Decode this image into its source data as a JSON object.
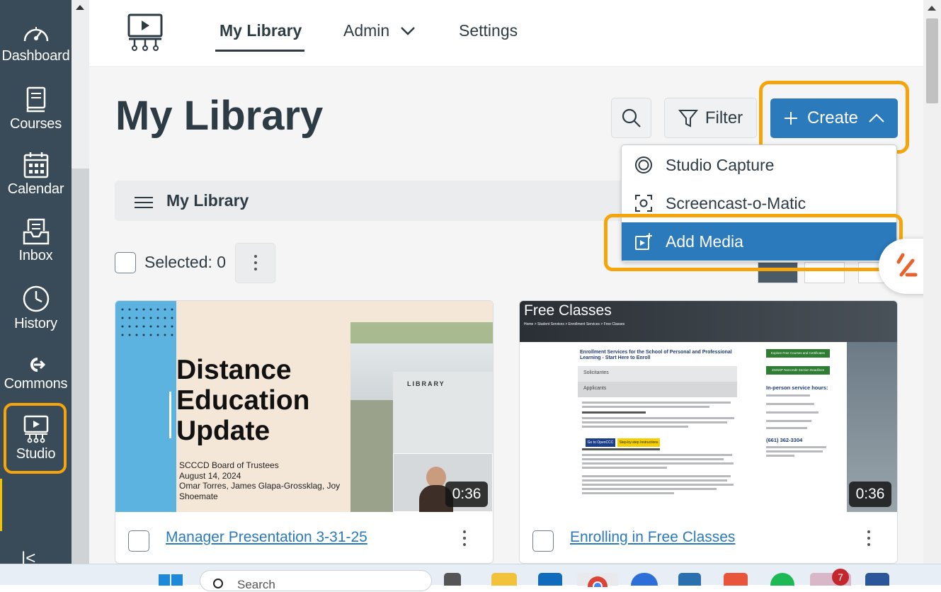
{
  "sidebar": {
    "items": [
      {
        "label": "Dashboard",
        "icon": "dashboard-icon"
      },
      {
        "label": "Courses",
        "icon": "courses-icon"
      },
      {
        "label": "Calendar",
        "icon": "calendar-icon"
      },
      {
        "label": "Inbox",
        "icon": "inbox-icon"
      },
      {
        "label": "History",
        "icon": "history-icon"
      },
      {
        "label": "Commons",
        "icon": "commons-icon"
      },
      {
        "label": "Studio",
        "icon": "studio-icon"
      }
    ],
    "collapse_glyph": "|<"
  },
  "topnav": {
    "tabs": [
      {
        "label": "My Library",
        "active": true
      },
      {
        "label": "Admin"
      },
      {
        "label": "Settings"
      }
    ]
  },
  "page": {
    "title": "My Library",
    "filter_label": "Filter",
    "create_label": "Create",
    "breadcrumb": "My Library",
    "selected_label": "Selected: 0"
  },
  "create_menu": {
    "items": [
      {
        "label": "Studio Capture",
        "icon": "studio-capture-icon"
      },
      {
        "label": "Screencast-o-Matic",
        "icon": "screencast-icon"
      },
      {
        "label": "Add Media",
        "icon": "add-media-icon",
        "active": true
      }
    ]
  },
  "cards": [
    {
      "title": "Manager Presentation 3-31-25",
      "duration": "0:36",
      "thumb": {
        "heading": [
          "Distance",
          "Education",
          "Update"
        ],
        "lines": [
          "SCCCD Board of Trustees",
          "August 14, 2024",
          "Omar Torres, James Glapa-Grossklag, Joy",
          "Shoemate"
        ],
        "sign": "LIBRARY"
      }
    },
    {
      "title": "Enrolling in Free Classes",
      "duration": "0:36",
      "thumb": {
        "banner": "Free Classes",
        "crumb": "Home > Student Services > Enrollment Services > Free Classes",
        "heading": "Enrollment Services for the School of Personal and Professional Learning - Start Here to Enroll",
        "nav": [
          "Solicitantes",
          "Applicants"
        ],
        "side_buttons": [
          "Explore Free Courses and Certificates",
          "2025SP Noncredit Section Deadlines"
        ],
        "hours_title": "In-person service hours:",
        "phone": "(661) 362-3304",
        "buttons": [
          "Go to OpenCCC",
          "Step-by-step Instructions"
        ]
      }
    }
  ],
  "taskbar": {
    "search_placeholder": "Search",
    "badge": "7"
  },
  "colors": {
    "sidebar": "#394b58",
    "brand_blue": "#2b7abc",
    "highlight": "#f5a50a"
  }
}
